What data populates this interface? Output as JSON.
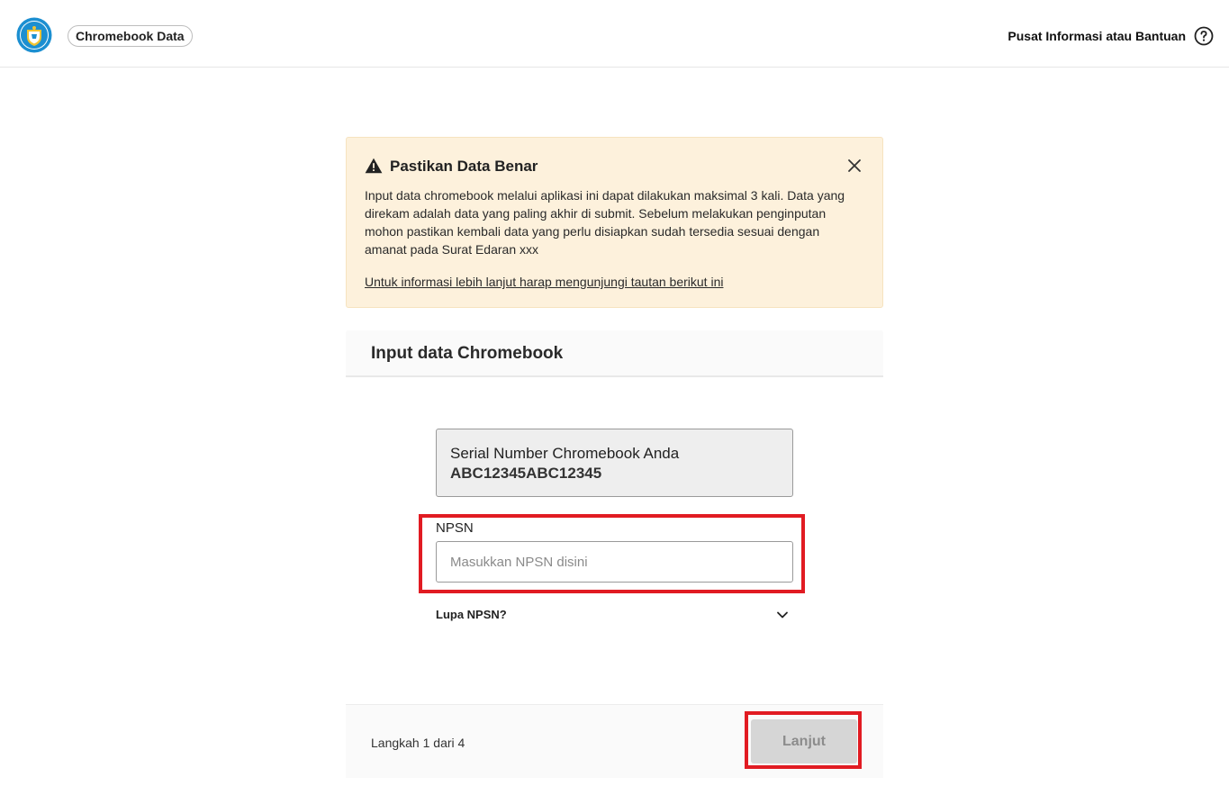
{
  "header": {
    "app_name": "Chromebook Data",
    "help_label": "Pusat Informasi atau Bantuan",
    "logo_icon": "tut-wuri-handayani-logo",
    "help_icon": "question-circle-icon"
  },
  "alert": {
    "title": "Pastikan Data Benar",
    "body": "Input data chromebook melalui aplikasi ini dapat dilakukan maksimal 3 kali. Data yang direkam adalah data yang paling akhir di submit. Sebelum melakukan penginputan mohon pastikan kembali data yang perlu disiapkan sudah tersedia sesuai dengan amanat pada Surat Edaran xxx",
    "link": "Untuk informasi lebih lanjut harap mengunjungi tautan berikut ini",
    "warn_icon": "warning-triangle-icon",
    "close_icon": "close-icon",
    "background_color": "#fdf1dc"
  },
  "form": {
    "title": "Input data Chromebook",
    "serial_label": "Serial Number Chromebook Anda",
    "serial_value": "ABC12345ABC12345",
    "npsn_label": "NPSN",
    "npsn_value": "",
    "npsn_placeholder": "Masukkan NPSN disini",
    "forgot_label": "Lupa NPSN?",
    "forgot_icon": "chevron-down-icon"
  },
  "footer": {
    "step_text": "Langkah 1 dari 4",
    "next_label": "Lanjut",
    "next_disabled": true
  },
  "colors": {
    "highlight": "#e11b22",
    "logo_blue": "#1c8fd1"
  }
}
